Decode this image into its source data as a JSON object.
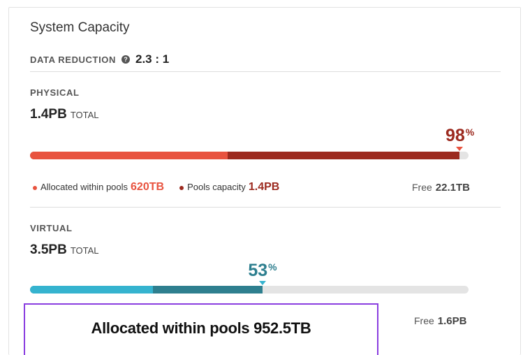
{
  "panel": {
    "title": "System Capacity"
  },
  "data_reduction": {
    "label": "DATA REDUCTION",
    "help_icon": "question-circle-icon",
    "value": "2.3 : 1"
  },
  "physical": {
    "label": "PHYSICAL",
    "total_value": "1.4PB",
    "total_unit": "TOTAL",
    "percent": "98",
    "percent_symbol": "%",
    "percent_value": 98,
    "allocated_fraction": 0.45,
    "color_light": "#e8533f",
    "color_dark": "#9c2a1f",
    "legend": [
      {
        "label": "Allocated within pools",
        "value": "620TB",
        "color": "#e8533f"
      },
      {
        "label": "Pools capacity",
        "value": "1.4PB",
        "color": "#9c2a1f"
      }
    ],
    "free_label": "Free",
    "free_value": "22.1TB"
  },
  "virtual": {
    "label": "VIRTUAL",
    "total_value": "3.5PB",
    "total_unit": "TOTAL",
    "percent": "53",
    "percent_symbol": "%",
    "percent_value": 53,
    "allocated_fraction": 0.28,
    "color_light": "#35b3cf",
    "color_dark": "#2e7f8f",
    "free_label": "Free",
    "free_value": "1.6PB"
  },
  "tooltip": {
    "text": "Allocated within pools 952.5TB"
  }
}
